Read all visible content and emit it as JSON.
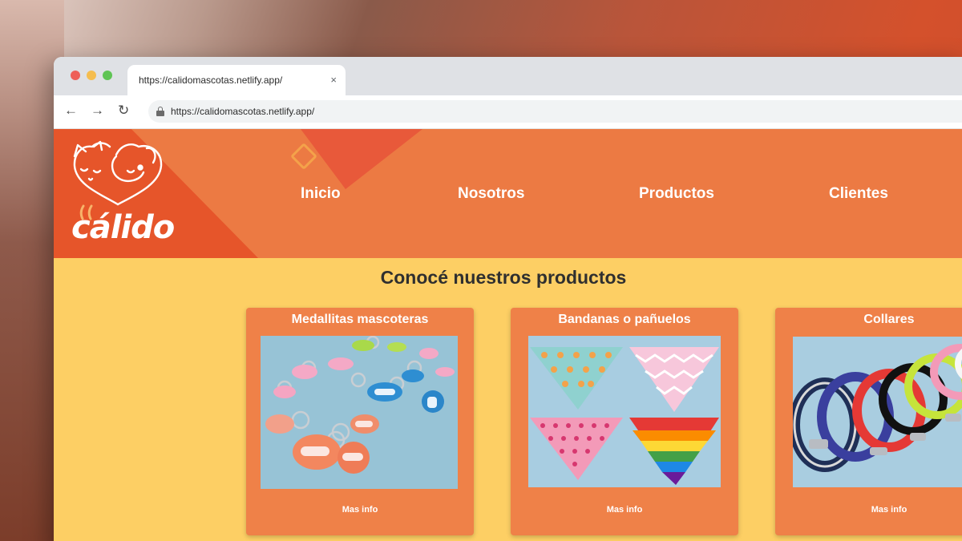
{
  "browser": {
    "tab_title": "https://calidomascotas.netlify.app/",
    "tab_close": "×",
    "url": "https://calidomascotas.netlify.app/",
    "back_glyph": "←",
    "forward_glyph": "→",
    "reload_glyph": "↻"
  },
  "site": {
    "logo_text": "cálido",
    "nav": [
      "Inicio",
      "Nosotros",
      "Productos",
      "Clientes"
    ],
    "section_title": "Conocé nuestros productos",
    "products": [
      {
        "title": "Medallitas mascoteras",
        "link": "Mas info",
        "image": "pet-tags-photo"
      },
      {
        "title": "Bandanas o pañuelos",
        "link": "Mas info",
        "image": "bandanas-photo"
      },
      {
        "title": "Collares",
        "link": "Mas info",
        "image": "collars-photo"
      }
    ]
  },
  "colors": {
    "header_orange": "#ec7a43",
    "logo_red": "#e6552a",
    "page_yellow": "#fdcf64",
    "card_orange": "#ef8148"
  }
}
